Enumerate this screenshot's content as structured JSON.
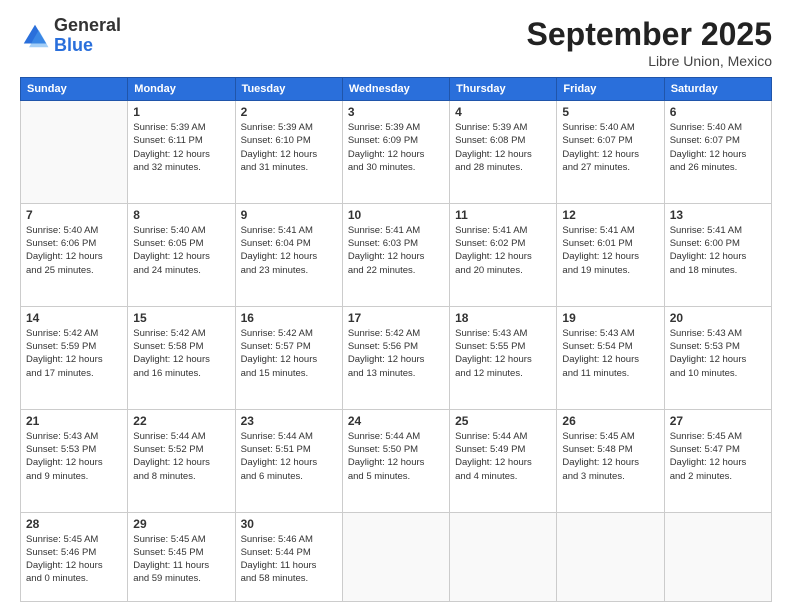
{
  "header": {
    "logo": {
      "line1": "General",
      "line2": "Blue"
    },
    "month": "September 2025",
    "location": "Libre Union, Mexico"
  },
  "weekdays": [
    "Sunday",
    "Monday",
    "Tuesday",
    "Wednesday",
    "Thursday",
    "Friday",
    "Saturday"
  ],
  "weeks": [
    [
      {
        "day": "",
        "info": ""
      },
      {
        "day": "1",
        "info": "Sunrise: 5:39 AM\nSunset: 6:11 PM\nDaylight: 12 hours\nand 32 minutes."
      },
      {
        "day": "2",
        "info": "Sunrise: 5:39 AM\nSunset: 6:10 PM\nDaylight: 12 hours\nand 31 minutes."
      },
      {
        "day": "3",
        "info": "Sunrise: 5:39 AM\nSunset: 6:09 PM\nDaylight: 12 hours\nand 30 minutes."
      },
      {
        "day": "4",
        "info": "Sunrise: 5:39 AM\nSunset: 6:08 PM\nDaylight: 12 hours\nand 28 minutes."
      },
      {
        "day": "5",
        "info": "Sunrise: 5:40 AM\nSunset: 6:07 PM\nDaylight: 12 hours\nand 27 minutes."
      },
      {
        "day": "6",
        "info": "Sunrise: 5:40 AM\nSunset: 6:07 PM\nDaylight: 12 hours\nand 26 minutes."
      }
    ],
    [
      {
        "day": "7",
        "info": "Sunrise: 5:40 AM\nSunset: 6:06 PM\nDaylight: 12 hours\nand 25 minutes."
      },
      {
        "day": "8",
        "info": "Sunrise: 5:40 AM\nSunset: 6:05 PM\nDaylight: 12 hours\nand 24 minutes."
      },
      {
        "day": "9",
        "info": "Sunrise: 5:41 AM\nSunset: 6:04 PM\nDaylight: 12 hours\nand 23 minutes."
      },
      {
        "day": "10",
        "info": "Sunrise: 5:41 AM\nSunset: 6:03 PM\nDaylight: 12 hours\nand 22 minutes."
      },
      {
        "day": "11",
        "info": "Sunrise: 5:41 AM\nSunset: 6:02 PM\nDaylight: 12 hours\nand 20 minutes."
      },
      {
        "day": "12",
        "info": "Sunrise: 5:41 AM\nSunset: 6:01 PM\nDaylight: 12 hours\nand 19 minutes."
      },
      {
        "day": "13",
        "info": "Sunrise: 5:41 AM\nSunset: 6:00 PM\nDaylight: 12 hours\nand 18 minutes."
      }
    ],
    [
      {
        "day": "14",
        "info": "Sunrise: 5:42 AM\nSunset: 5:59 PM\nDaylight: 12 hours\nand 17 minutes."
      },
      {
        "day": "15",
        "info": "Sunrise: 5:42 AM\nSunset: 5:58 PM\nDaylight: 12 hours\nand 16 minutes."
      },
      {
        "day": "16",
        "info": "Sunrise: 5:42 AM\nSunset: 5:57 PM\nDaylight: 12 hours\nand 15 minutes."
      },
      {
        "day": "17",
        "info": "Sunrise: 5:42 AM\nSunset: 5:56 PM\nDaylight: 12 hours\nand 13 minutes."
      },
      {
        "day": "18",
        "info": "Sunrise: 5:43 AM\nSunset: 5:55 PM\nDaylight: 12 hours\nand 12 minutes."
      },
      {
        "day": "19",
        "info": "Sunrise: 5:43 AM\nSunset: 5:54 PM\nDaylight: 12 hours\nand 11 minutes."
      },
      {
        "day": "20",
        "info": "Sunrise: 5:43 AM\nSunset: 5:53 PM\nDaylight: 12 hours\nand 10 minutes."
      }
    ],
    [
      {
        "day": "21",
        "info": "Sunrise: 5:43 AM\nSunset: 5:53 PM\nDaylight: 12 hours\nand 9 minutes."
      },
      {
        "day": "22",
        "info": "Sunrise: 5:44 AM\nSunset: 5:52 PM\nDaylight: 12 hours\nand 8 minutes."
      },
      {
        "day": "23",
        "info": "Sunrise: 5:44 AM\nSunset: 5:51 PM\nDaylight: 12 hours\nand 6 minutes."
      },
      {
        "day": "24",
        "info": "Sunrise: 5:44 AM\nSunset: 5:50 PM\nDaylight: 12 hours\nand 5 minutes."
      },
      {
        "day": "25",
        "info": "Sunrise: 5:44 AM\nSunset: 5:49 PM\nDaylight: 12 hours\nand 4 minutes."
      },
      {
        "day": "26",
        "info": "Sunrise: 5:45 AM\nSunset: 5:48 PM\nDaylight: 12 hours\nand 3 minutes."
      },
      {
        "day": "27",
        "info": "Sunrise: 5:45 AM\nSunset: 5:47 PM\nDaylight: 12 hours\nand 2 minutes."
      }
    ],
    [
      {
        "day": "28",
        "info": "Sunrise: 5:45 AM\nSunset: 5:46 PM\nDaylight: 12 hours\nand 0 minutes."
      },
      {
        "day": "29",
        "info": "Sunrise: 5:45 AM\nSunset: 5:45 PM\nDaylight: 11 hours\nand 59 minutes."
      },
      {
        "day": "30",
        "info": "Sunrise: 5:46 AM\nSunset: 5:44 PM\nDaylight: 11 hours\nand 58 minutes."
      },
      {
        "day": "",
        "info": ""
      },
      {
        "day": "",
        "info": ""
      },
      {
        "day": "",
        "info": ""
      },
      {
        "day": "",
        "info": ""
      }
    ]
  ]
}
